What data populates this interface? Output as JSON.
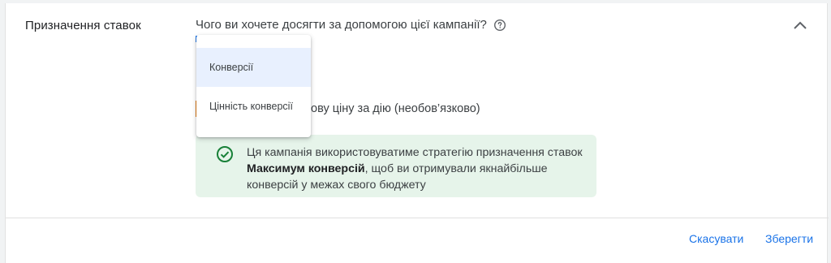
{
  "section": {
    "title": "Призначення ставок",
    "question": "Чого ви хочете досягти за допомогою цієї кампанії?"
  },
  "dropdown": {
    "options": [
      {
        "label": "Конверсії",
        "selected": true
      },
      {
        "label": "Цінність конверсії",
        "selected": false
      }
    ]
  },
  "bid_option": {
    "label_visible": "ову ціну за дію (необов’язково)"
  },
  "info": {
    "text_before": "Ця кампанія використовуватиме стратегію призначення ставок ",
    "strategy": "Максимум конверсій",
    "text_after": ", щоб ви отримували якнайбільше конверсій у межах свого бюджету"
  },
  "footer": {
    "cancel_label": "Скасувати",
    "save_label": "Зберегти"
  },
  "colors": {
    "accent": "#1a73e8",
    "success": "#188038",
    "info_background": "#e6f4ea",
    "selected_option_background": "#e8f0fe"
  },
  "icons": {
    "help": "help-circle-icon",
    "collapse": "chevron-up-icon",
    "status": "check-circle-icon"
  }
}
